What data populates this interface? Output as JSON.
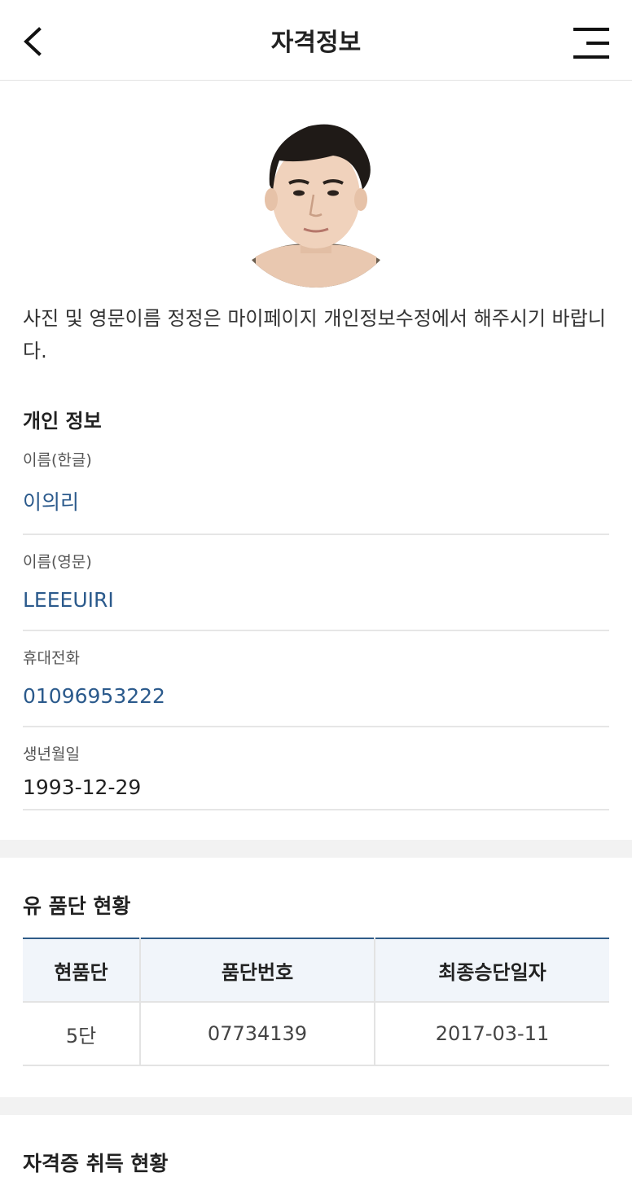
{
  "header": {
    "title": "자격정보"
  },
  "profile": {
    "notice": "사진 및 영문이름 정정은 마이페이지 개인정보수정에서 해주시기 바랍니다."
  },
  "personal": {
    "title": "개인 정보",
    "fields": [
      {
        "label": "이름(한글)",
        "value": "이의리"
      },
      {
        "label": "이름(영문)",
        "value": "LEEEUIRI"
      },
      {
        "label": "휴대전화",
        "value": "01096953222"
      },
      {
        "label": "생년월일",
        "value": "1993-12-29"
      }
    ]
  },
  "rank": {
    "title": "유 품단 현황",
    "headers": [
      "현품단",
      "품단번호",
      "최종승단일자"
    ],
    "rows": [
      [
        "5단",
        "07734139",
        "2017-03-11"
      ]
    ]
  },
  "certificate": {
    "title": "자격증 취득 현황"
  },
  "colors": {
    "accent": "#2b5a8c",
    "table_header_bg": "#f1f5fa",
    "divider": "#f2f2f2"
  },
  "icons": {
    "back": "chevron-left-icon",
    "menu": "hamburger-menu-icon",
    "avatar": "user-photo"
  }
}
